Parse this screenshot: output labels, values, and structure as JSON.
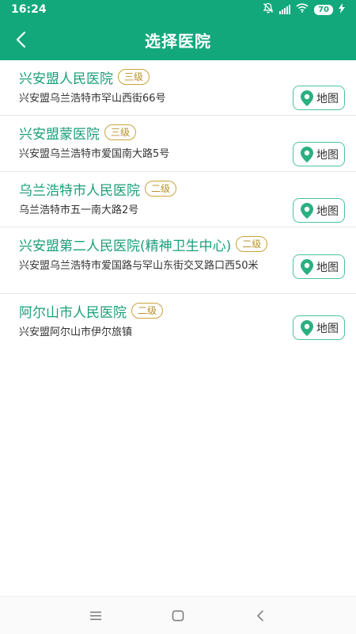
{
  "status": {
    "time": "16:24",
    "battery": "70"
  },
  "header": {
    "title": "选择医院"
  },
  "map_label": "地图",
  "hospitals": [
    {
      "name": "兴安盟人民医院",
      "level": "三级",
      "address": "兴安盟乌兰浩特市罕山西街66号"
    },
    {
      "name": "兴安盟蒙医院",
      "level": "三级",
      "address": "兴安盟乌兰浩特市爱国南大路5号"
    },
    {
      "name": "乌兰浩特市人民医院",
      "level": "二级",
      "address": "乌兰浩特市五一南大路2号"
    },
    {
      "name": "兴安盟第二人民医院(精神卫生中心)",
      "level": "二级",
      "address": "兴安盟乌兰浩特市爱国路与罕山东街交叉路口西50米"
    },
    {
      "name": "阿尔山市人民医院",
      "level": "二级",
      "address": "兴安盟阿尔山市伊尔旅镇"
    }
  ],
  "colors": {
    "accent": "#13a87c",
    "name_text": "#1a9f7a",
    "level_border": "#c9a53b",
    "map_border": "#4dc497"
  }
}
